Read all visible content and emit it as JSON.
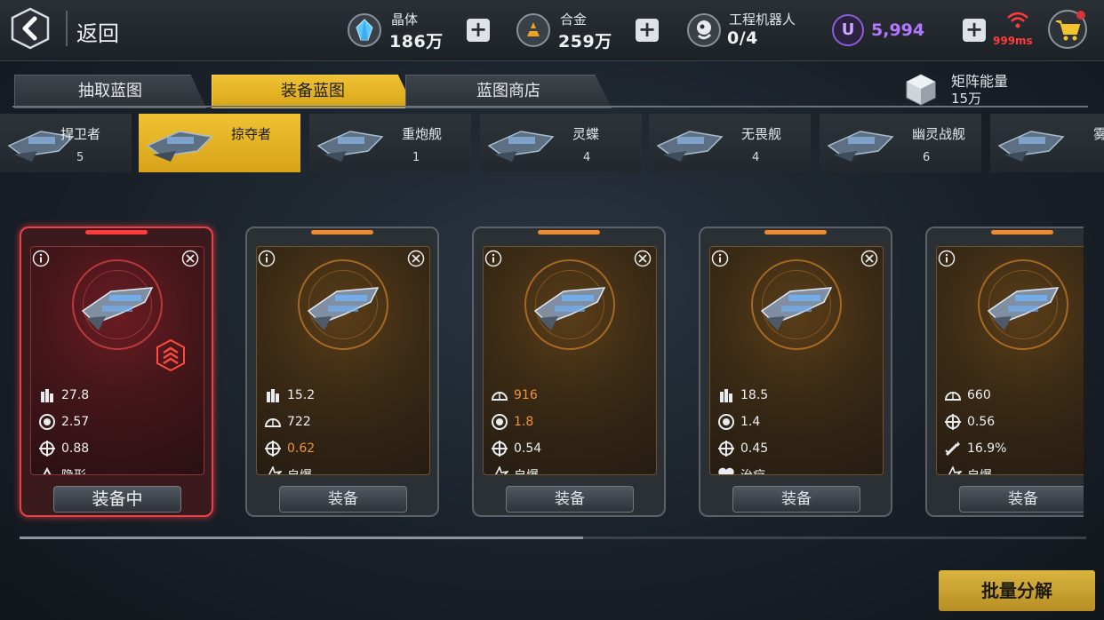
{
  "header": {
    "back_label": "返回",
    "resources": [
      {
        "icon": "crystal-icon",
        "label": "晶体",
        "value": "186万"
      },
      {
        "icon": "alloy-icon",
        "label": "合金",
        "value": "259万"
      },
      {
        "icon": "robot-icon",
        "label": "工程机器人",
        "value": "0/4"
      }
    ],
    "u_currency": {
      "icon": "u-coin-icon",
      "letter": "U",
      "value": "5,994"
    },
    "ping": "999ms",
    "cart_icon": "cart-icon"
  },
  "tabs": [
    {
      "label": "抽取蓝图",
      "active": false
    },
    {
      "label": "装备蓝图",
      "active": true
    },
    {
      "label": "蓝图商店",
      "active": false
    }
  ],
  "matrix_energy": {
    "label": "矩阵能量",
    "value": "15万"
  },
  "ships": [
    {
      "name": "捍卫者",
      "count": "5",
      "selected": false
    },
    {
      "name": "掠夺者",
      "count": "",
      "selected": true
    },
    {
      "name": "重炮舰",
      "count": "1",
      "selected": false
    },
    {
      "name": "灵蝶",
      "count": "4",
      "selected": false
    },
    {
      "name": "无畏舰",
      "count": "4",
      "selected": false
    },
    {
      "name": "幽灵战舰",
      "count": "6",
      "selected": false
    },
    {
      "name": "雾",
      "count": "",
      "selected": false
    }
  ],
  "cards": [
    {
      "equipped": true,
      "button": "装备中",
      "stats": [
        {
          "icon": "ammo-icon",
          "text": "27.8",
          "highlight": false
        },
        {
          "icon": "rate-icon",
          "text": "2.57",
          "highlight": false
        },
        {
          "icon": "crosshair-icon",
          "text": "0.88",
          "highlight": false
        },
        {
          "icon": "stealth-icon",
          "text": "隐形",
          "highlight": false
        }
      ]
    },
    {
      "equipped": false,
      "button": "装备",
      "stats": [
        {
          "icon": "ammo-icon",
          "text": "15.2",
          "highlight": false
        },
        {
          "icon": "shield-arc-icon",
          "text": "722",
          "highlight": false
        },
        {
          "icon": "crosshair-icon",
          "text": "0.62",
          "highlight": true
        },
        {
          "icon": "explode-icon",
          "text": "自爆",
          "highlight": false
        }
      ]
    },
    {
      "equipped": false,
      "button": "装备",
      "stats": [
        {
          "icon": "shield-arc-icon",
          "text": "916",
          "highlight": true
        },
        {
          "icon": "rate-icon",
          "text": "1.8",
          "highlight": true
        },
        {
          "icon": "crosshair-icon",
          "text": "0.54",
          "highlight": false
        },
        {
          "icon": "explode-icon",
          "text": "自爆",
          "highlight": false
        }
      ]
    },
    {
      "equipped": false,
      "button": "装备",
      "stats": [
        {
          "icon": "ammo-icon",
          "text": "18.5",
          "highlight": false
        },
        {
          "icon": "rate-icon",
          "text": "1.4",
          "highlight": false
        },
        {
          "icon": "crosshair-icon",
          "text": "0.45",
          "highlight": false
        },
        {
          "icon": "heal-icon",
          "text": "治疗",
          "highlight": false
        }
      ]
    },
    {
      "equipped": false,
      "button": "装备",
      "stats": [
        {
          "icon": "shield-arc-icon",
          "text": "660",
          "highlight": false
        },
        {
          "icon": "crosshair-icon",
          "text": "0.56",
          "highlight": false
        },
        {
          "icon": "missile-icon",
          "text": "16.9%",
          "highlight": false
        },
        {
          "icon": "explode-icon",
          "text": "自爆",
          "highlight": false
        }
      ]
    }
  ],
  "bulk_button": "批量分解",
  "colors": {
    "accent": "#f0c233",
    "equipped": "#e3434a",
    "highlight": "#f1923a",
    "u_currency": "#b377ff"
  }
}
